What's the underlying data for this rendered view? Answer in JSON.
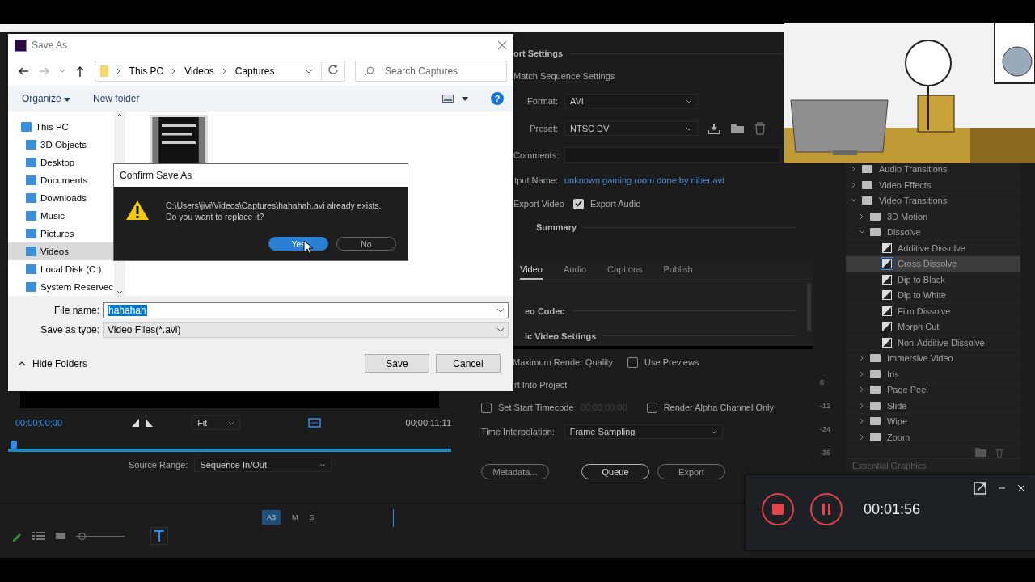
{
  "save_as": {
    "title": "Save As",
    "path": [
      "This PC",
      "Videos",
      "Captures"
    ],
    "search_placeholder": "Search Captures",
    "organize": "Organize",
    "new_folder": "New folder",
    "sidebar": [
      {
        "label": "This PC",
        "selected": false,
        "indent": false
      },
      {
        "label": "3D Objects",
        "selected": false,
        "indent": true
      },
      {
        "label": "Desktop",
        "selected": false,
        "indent": true
      },
      {
        "label": "Documents",
        "selected": false,
        "indent": true
      },
      {
        "label": "Downloads",
        "selected": false,
        "indent": true
      },
      {
        "label": "Music",
        "selected": false,
        "indent": true
      },
      {
        "label": "Pictures",
        "selected": false,
        "indent": true
      },
      {
        "label": "Videos",
        "selected": true,
        "indent": true
      },
      {
        "label": "Local Disk (C:)",
        "selected": false,
        "indent": true
      },
      {
        "label": "System Reservec",
        "selected": false,
        "indent": true
      }
    ],
    "help": "?",
    "file_name_label": "File name:",
    "file_name": "hahahah",
    "type_label": "Save as type:",
    "type_value": "Video Files(*.avi)",
    "hide_folders": "Hide Folders",
    "buttons": [
      "Save",
      "Cancel"
    ]
  },
  "confirm": {
    "title": "Confirm Save As",
    "message": [
      "C:\\Users\\jivi\\Videos\\Captures\\hahahah.avi already exists.",
      "Do you want to replace it?"
    ],
    "buttons": [
      {
        "label": "Yes",
        "selected": true
      },
      {
        "label": "No",
        "selected": false
      }
    ]
  },
  "export_settings": {
    "heading": "ort Settings",
    "match": "Match Sequence Settings",
    "format_label": "Format:",
    "format": "AVI",
    "preset_label": "Preset:",
    "preset": "NTSC DV",
    "comments_label": "Comments:",
    "output_label": "tput Name:",
    "output_name": "unknown gaming room done by niber.avi",
    "export_video": "Export Video",
    "export_audio": {
      "label": "Export Audio",
      "checked": true
    },
    "summary": "Summary",
    "tabs": [
      {
        "label": "Video",
        "selected": true
      },
      {
        "label": "Audio",
        "selected": false
      },
      {
        "label": "Captions",
        "selected": false
      },
      {
        "label": "Publish",
        "selected": false
      }
    ],
    "sections": [
      "eo Codec",
      "ic Video Settings"
    ],
    "max_render": "Maximum Render Quality",
    "use_previews": {
      "label": "Use Previews",
      "checked": false
    },
    "import_project": "rt Into Project",
    "start_timecode": {
      "label": "Set Start Timecode",
      "checked": false,
      "value": "00;00;00;00"
    },
    "render_alpha": {
      "label": "Render Alpha Channel Only",
      "checked": false
    },
    "interp_label": "Time Interpolation:",
    "interp_value": "Frame Sampling",
    "buttons": [
      "Metadata...",
      "Queue",
      "Export"
    ],
    "meter_ticks": [
      "0",
      "-12",
      "-24",
      "-36"
    ]
  },
  "effects": {
    "items": [
      {
        "label": "Audio Transitions",
        "expanded": false,
        "selected": false
      },
      {
        "label": "Video Effects",
        "expanded": false,
        "selected": false
      },
      {
        "label": "Video Transitions",
        "expanded": true,
        "selected": false,
        "children": [
          {
            "label": "3D Motion",
            "expanded": false,
            "selected": false
          },
          {
            "label": "Dissolve",
            "expanded": true,
            "selected": false,
            "children": [
              {
                "label": "Additive Dissolve",
                "selected": false
              },
              {
                "label": "Cross Dissolve",
                "selected": true
              },
              {
                "label": "Dip to Black",
                "selected": false
              },
              {
                "label": "Dip to White",
                "selected": false
              },
              {
                "label": "Film Dissolve",
                "selected": false
              },
              {
                "label": "Morph Cut",
                "selected": false
              },
              {
                "label": "Non-Additive Dissolve",
                "selected": false
              }
            ]
          },
          {
            "label": "Immersive Video",
            "expanded": false,
            "selected": false
          },
          {
            "label": "Iris",
            "expanded": false,
            "selected": false
          },
          {
            "label": "Page Peel",
            "expanded": false,
            "selected": false
          },
          {
            "label": "Slide",
            "expanded": false,
            "selected": false
          },
          {
            "label": "Wipe",
            "expanded": false,
            "selected": false
          },
          {
            "label": "Zoom",
            "expanded": false,
            "selected": false
          }
        ]
      }
    ],
    "footer": "Essential Graphics"
  },
  "source_monitor": {
    "timecode_in": "00;00;00;00",
    "fit": "Fit",
    "timecode_out": "00;00;11;11",
    "range_label": "Source Range:",
    "range_value": "Sequence In/Out"
  },
  "timeline": {
    "zoom_slider": {
      "level": 0.05
    },
    "track": "A3",
    "mute": "M",
    "solo": "S"
  },
  "recorder": {
    "time": "00:01:56"
  }
}
